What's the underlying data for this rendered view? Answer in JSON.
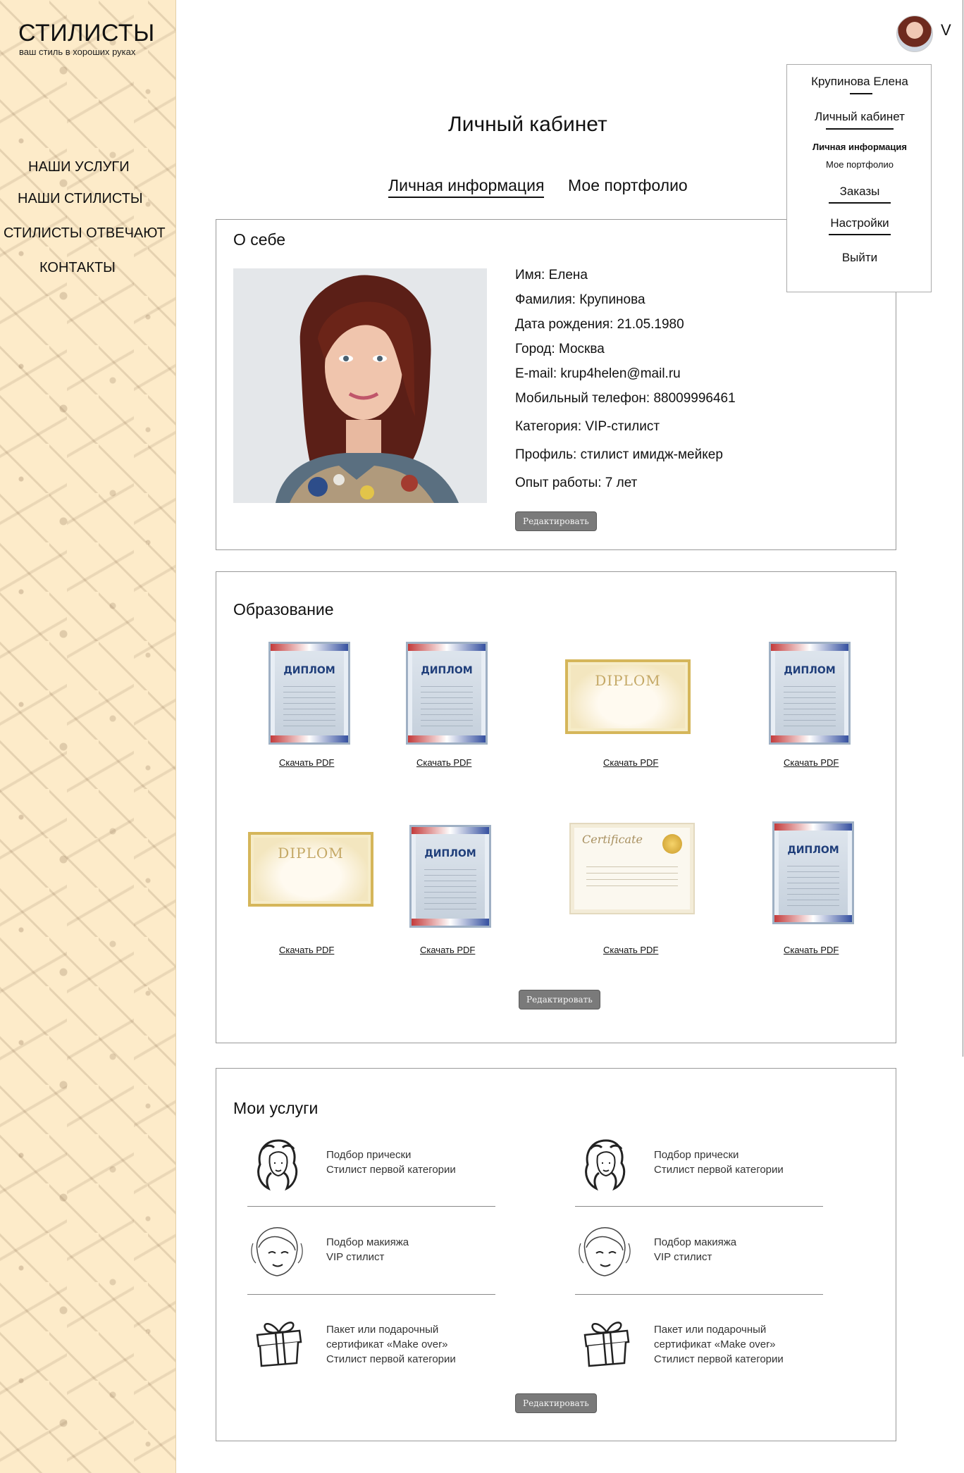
{
  "brand": {
    "title": "СТИЛИСТЫ",
    "tagline": "ваш стиль в хороших руках"
  },
  "nav": [
    "НАШИ УСЛУГИ",
    "НАШИ СТИЛИСТЫ",
    "СТИЛИСТЫ ОТВЕЧАЮТ",
    "КОНТАКТЫ"
  ],
  "user_menu": {
    "name": "Крупинова Елена",
    "items": [
      "Личный кабинет",
      "Личная информация",
      "Мое портфолио",
      "Заказы",
      "Настройки",
      "Выйти"
    ],
    "caret": "V"
  },
  "page": {
    "title": "Личный кабинет",
    "tabs": [
      "Личная информация",
      "Мое портфолио"
    ]
  },
  "about": {
    "title": "О себе",
    "fields": [
      "Имя: Елена",
      "Фамилия: Крупинова",
      "Дата рождения: 21.05.1980",
      "Город: Москва",
      "E-mail: krup4helen@mail.ru",
      "Мобильный телефон: 88009996461",
      "Категория: VIP-стилист",
      "Профиль: стилист имидж-мейкер",
      "Опыт работы: 7 лет"
    ],
    "edit_label": "Редактировать"
  },
  "education": {
    "title": "Образование",
    "documents": [
      {
        "kind": "diplom-blue",
        "word": "ДИПЛОМ",
        "link": "Скачать PDF"
      },
      {
        "kind": "diplom-blue",
        "word": "ДИПЛОМ",
        "link": "Скачать PDF"
      },
      {
        "kind": "diplom-gold",
        "word": "DIPLOM",
        "link": "Скачать PDF"
      },
      {
        "kind": "diplom-blue",
        "word": "ДИПЛОМ",
        "link": "Скачать PDF"
      },
      {
        "kind": "diplom-gold",
        "word": "DIPLOM",
        "link": "Скачать PDF"
      },
      {
        "kind": "diplom-blue",
        "word": "ДИПЛОМ",
        "link": "Скачать PDF"
      },
      {
        "kind": "certificate",
        "word": "Certificate",
        "link": "Скачать PDF"
      },
      {
        "kind": "diplom-blue",
        "word": "ДИПЛОМ",
        "link": "Скачать PDF"
      }
    ],
    "edit_label": "Редактировать"
  },
  "services": {
    "title": "Мои услуги",
    "items": [
      {
        "icon": "hair-icon",
        "lines": [
          "Подбор прически",
          "Стилист первой категории"
        ]
      },
      {
        "icon": "hair-icon",
        "lines": [
          "Подбор прически",
          "Стилист первой категории"
        ]
      },
      {
        "icon": "makeup-icon",
        "lines": [
          "Подбор макияжа",
          "VIP стилист"
        ]
      },
      {
        "icon": "makeup-icon",
        "lines": [
          "Подбор макияжа",
          "VIP стилист"
        ]
      },
      {
        "icon": "gift-icon",
        "lines": [
          "Пакет или подарочный",
          "сертификат «Make over»",
          "Стилист первой категории"
        ]
      },
      {
        "icon": "gift-icon",
        "lines": [
          "Пакет или подарочный",
          "сертификат «Make over»",
          "Стилист первой категории"
        ]
      }
    ],
    "edit_label": "Редактировать"
  },
  "colors": {
    "sidebar_bg": "#fdebc9",
    "button_bg": "#7a7a7a",
    "border": "#999999"
  }
}
